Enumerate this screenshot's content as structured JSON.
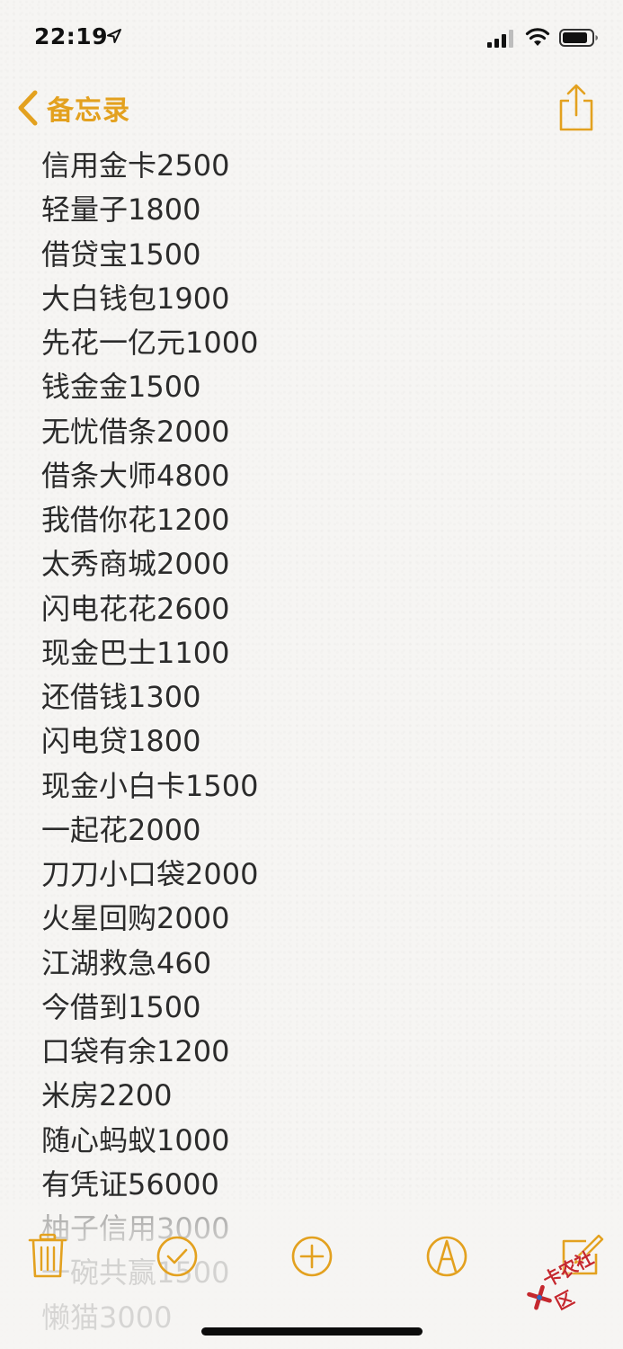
{
  "status_bar": {
    "time": "22:19"
  },
  "nav": {
    "back_label": "备忘录"
  },
  "note": {
    "lines": [
      "信用金卡2500",
      "轻量子1800",
      "借贷宝1500",
      "大白钱包1900",
      "先花一亿元1000",
      "钱金金1500",
      "无忧借条2000",
      "借条大师4800",
      "我借你花1200",
      "太秀商城2000",
      "闪电花花2600",
      "现金巴士1100",
      "还借钱1300",
      "闪电贷1800",
      "现金小白卡1500",
      "一起花2000",
      "刀刀小口袋2000",
      "火星回购2000",
      "江湖救急460",
      "今借到1500",
      "口袋有余1200",
      "米房2200",
      "随心蚂蚁1000",
      "有凭证56000",
      "柚子信用3000",
      "一碗共赢1500",
      "懒猫3000"
    ]
  },
  "toolbar": {
    "icons": [
      "trash-icon",
      "checklist-icon",
      "add-icon",
      "markup-icon",
      "compose-icon"
    ]
  },
  "watermark": {
    "text": "卡农社区"
  },
  "colors": {
    "accent": "#e3a11f",
    "text": "#2b2b2b",
    "background": "#f6f5f3"
  }
}
